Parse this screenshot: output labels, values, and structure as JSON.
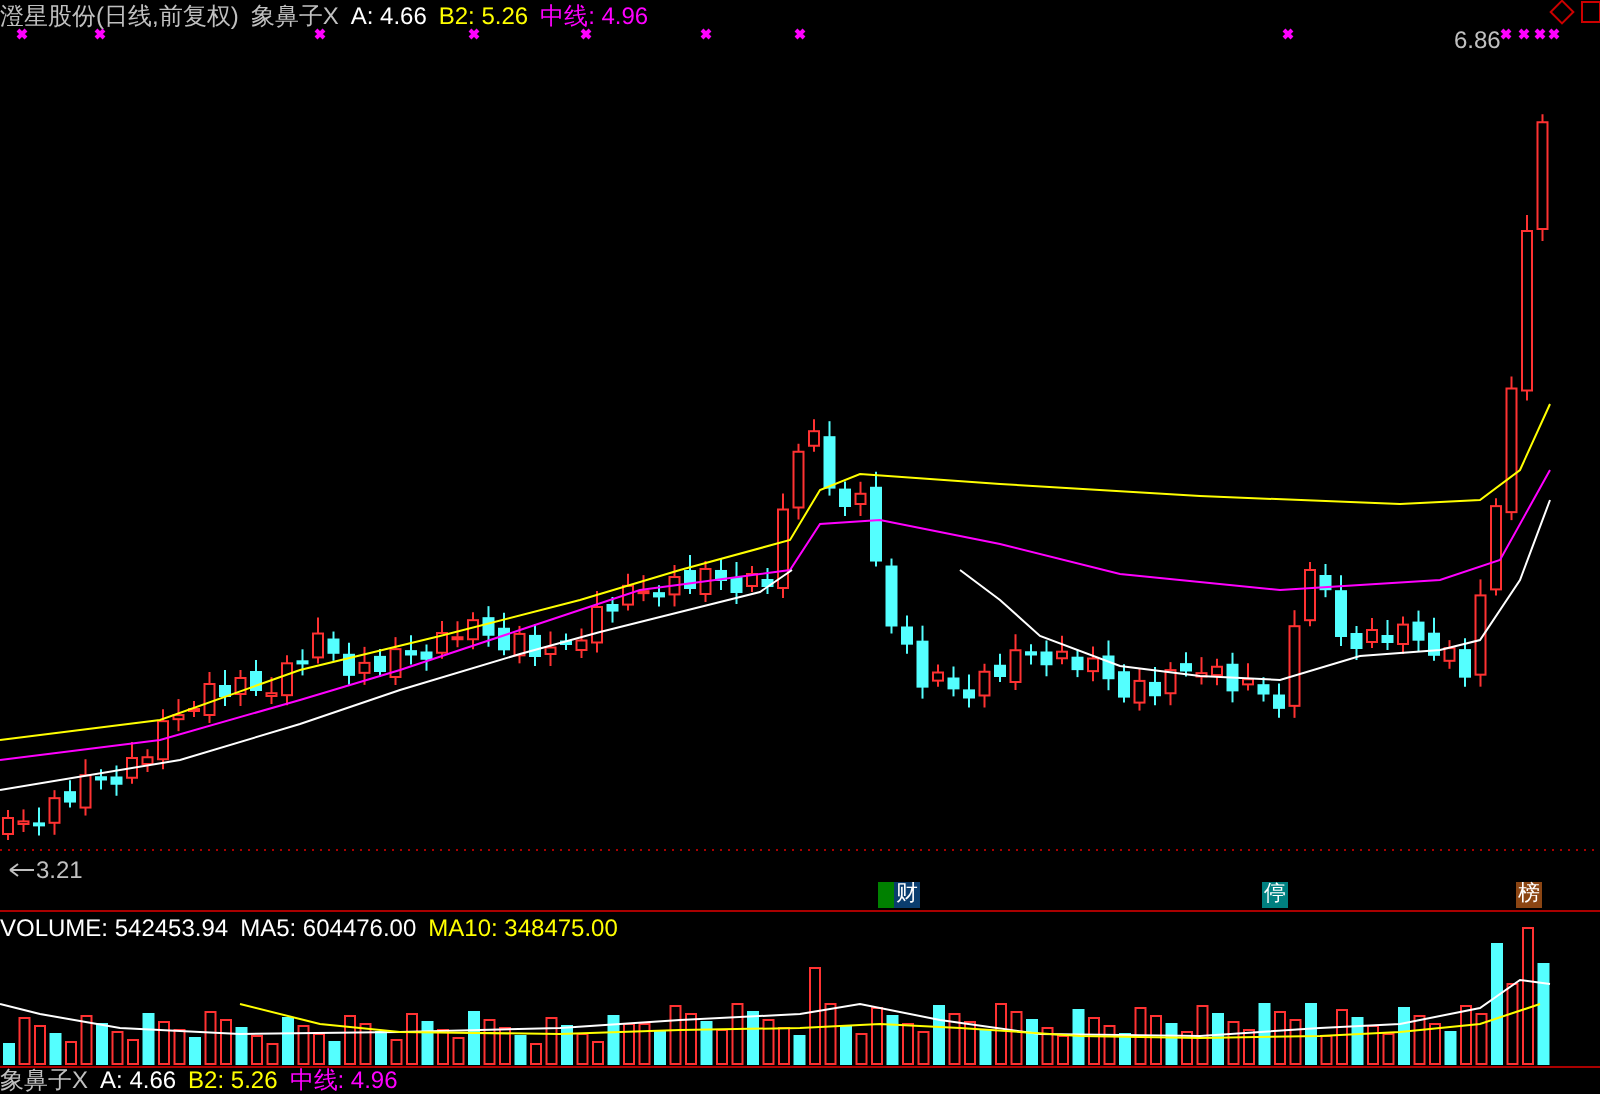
{
  "main_panel": {
    "title": "澄星股份(日线,前复权)",
    "indicator_name": "象鼻子X",
    "indicator_values": [
      {
        "label": "A: 4.66",
        "color": "#ffffff"
      },
      {
        "label": "B2: 5.26",
        "color": "#ffff00"
      },
      {
        "label": "中线: 4.96",
        "color": "#ff00ff"
      }
    ],
    "high_label": "6.86",
    "low_label": "3.21",
    "event_badges": [
      {
        "text": "财",
        "color": "#0a3d6e",
        "kind": "split"
      },
      {
        "text": "停",
        "color": "#008080",
        "kind": "plain"
      },
      {
        "text": "榜",
        "color": "#8b4513",
        "kind": "plain"
      }
    ]
  },
  "volume_panel": {
    "readings": [
      {
        "label": "VOLUME: 542453.94",
        "color": "#ffffff"
      },
      {
        "label": "MA5: 604476.00",
        "color": "#ffffff"
      },
      {
        "label": "MA10: 348475.00",
        "color": "#ffff00"
      }
    ]
  },
  "bottom_panel": {
    "indicator_name": "象鼻子X",
    "indicator_values": [
      {
        "label": "A: 4.66",
        "color": "#ffffff"
      },
      {
        "label": "B2: 5.26",
        "color": "#ffff00"
      },
      {
        "label": "中线: 4.96",
        "color": "#ff00ff"
      }
    ]
  }
}
